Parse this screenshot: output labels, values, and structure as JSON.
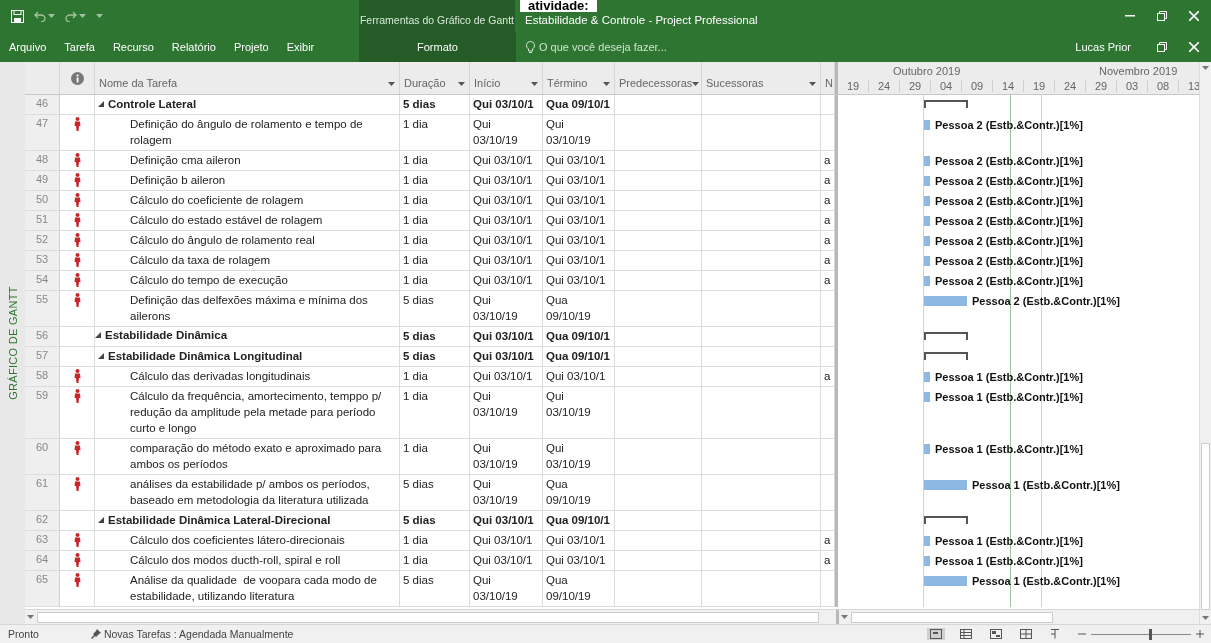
{
  "caption": "atividade:",
  "window": {
    "title": "Estabilidade & Controle - Project Professional",
    "context_group": "Ferramentas do Gráfico de Gantt",
    "search_placeholder": "O que você deseja fazer...",
    "user": "Lucas Prior"
  },
  "ribbon_tabs": [
    {
      "label": "Arquivo",
      "contextual": false
    },
    {
      "label": "Tarefa",
      "contextual": false
    },
    {
      "label": "Recurso",
      "contextual": false
    },
    {
      "label": "Relatório",
      "contextual": false
    },
    {
      "label": "Projeto",
      "contextual": false
    },
    {
      "label": "Exibir",
      "contextual": false
    },
    {
      "label": "Formato",
      "contextual": true
    }
  ],
  "view_label": "GRÁFICO DE GANTT",
  "columns": [
    {
      "label": "Nome da Tarefa",
      "menu": true
    },
    {
      "label": "Duração",
      "menu": true
    },
    {
      "label": "Início",
      "menu": true
    },
    {
      "label": "Término",
      "menu": true
    },
    {
      "label": "Predecessoras",
      "menu": true
    },
    {
      "label": "Sucessoras",
      "menu": true
    },
    {
      "label": "N",
      "menu": false
    }
  ],
  "timescale": {
    "months": [
      "Outubro 2019",
      "Novembro 2019"
    ],
    "days": [
      "19",
      "24",
      "29",
      "04",
      "09",
      "14",
      "19",
      "24",
      "29",
      "03",
      "08",
      "13"
    ]
  },
  "tasks": [
    {
      "children": [
        {
          "id": "46",
          "kind": "summary",
          "expanded": true,
          "overallocated": false,
          "name": "Controle Lateral",
          "duration": "5 dias",
          "start": "Qui 03/10/1",
          "finish": "Qua 09/10/1",
          "children": [
            {
              "id": "47",
              "kind": "task",
              "overallocated": true,
              "name": "Definição do ângulo de rolamento e tempo de rolagem",
              "duration": "1 dia",
              "start": "Qui 03/10/19",
              "finish": "Qui 03/10/19",
              "long_bar": false,
              "resources": "Pessoa 2 (Estb.&Contr.)[1%]"
            },
            {
              "id": "48",
              "kind": "task",
              "overallocated": true,
              "name": "Definição cma aileron",
              "duration": "1 dia",
              "start": "Qui 03/10/1",
              "finish": "Qui 03/10/1",
              "column_n": "a",
              "long_bar": false,
              "resources": "Pessoa 2 (Estb.&Contr.)[1%]"
            },
            {
              "id": "49",
              "kind": "task",
              "overallocated": true,
              "name": "Definição b aileron",
              "duration": "1 dia",
              "start": "Qui 03/10/1",
              "finish": "Qui 03/10/1",
              "column_n": "a",
              "long_bar": false,
              "resources": "Pessoa 2 (Estb.&Contr.)[1%]"
            },
            {
              "id": "50",
              "kind": "task",
              "overallocated": true,
              "name": "Cálculo do coeficiente de rolagem",
              "duration": "1 dia",
              "start": "Qui 03/10/1",
              "finish": "Qui 03/10/1",
              "column_n": "a",
              "long_bar": false,
              "resources": "Pessoa 2 (Estb.&Contr.)[1%]"
            },
            {
              "id": "51",
              "kind": "task",
              "overallocated": true,
              "name": "Cálculo do estado estável de rolagem",
              "duration": "1 dia",
              "start": "Qui 03/10/1",
              "finish": "Qui 03/10/1",
              "column_n": "a",
              "long_bar": false,
              "resources": "Pessoa 2 (Estb.&Contr.)[1%]"
            },
            {
              "id": "52",
              "kind": "task",
              "overallocated": true,
              "name": "Cálculo do ângulo de rolamento real",
              "duration": "1 dia",
              "start": "Qui 03/10/1",
              "finish": "Qui 03/10/1",
              "column_n": "a",
              "long_bar": false,
              "resources": "Pessoa 2 (Estb.&Contr.)[1%]"
            },
            {
              "id": "53",
              "kind": "task",
              "overallocated": true,
              "name": "Cálculo da taxa de rolagem",
              "duration": "1 dia",
              "start": "Qui 03/10/1",
              "finish": "Qui 03/10/1",
              "column_n": "a",
              "long_bar": false,
              "resources": "Pessoa 2 (Estb.&Contr.)[1%]"
            },
            {
              "id": "54",
              "kind": "task",
              "overallocated": true,
              "name": "Cálculo do tempo de execução",
              "duration": "1 dia",
              "start": "Qui 03/10/1",
              "finish": "Qui 03/10/1",
              "column_n": "a",
              "long_bar": false,
              "resources": "Pessoa 2 (Estb.&Contr.)[1%]"
            },
            {
              "id": "55",
              "kind": "task",
              "overallocated": true,
              "name": "Definição das delfexões máxima e mínima dos ailerons",
              "duration": "5 dias",
              "start": "Qui 03/10/19",
              "finish": "Qua 09/10/19",
              "long_bar": true,
              "resources": "Pessoa 2 (Estb.&Contr.)[1%]"
            }
          ]
        }
      ]
    },
    {
      "id": "56",
      "kind": "summary",
      "expanded": true,
      "overallocated": false,
      "name": "Estabilidade Dinâmica",
      "duration": "5 dias",
      "start": "Qui 03/10/1",
      "finish": "Qua 09/10/1",
      "children": [
        {
          "id": "57",
          "kind": "summary",
          "expanded": true,
          "overallocated": false,
          "name": "Estabilidade Dinâmica Longitudinal",
          "duration": "5 dias",
          "start": "Qui 03/10/1",
          "finish": "Qua 09/10/1",
          "children": [
            {
              "id": "58",
              "kind": "task",
              "overallocated": true,
              "name": "Cálculo das derivadas longitudinais",
              "duration": "1 dia",
              "start": "Qui 03/10/1",
              "finish": "Qui 03/10/1",
              "column_n": "a",
              "long_bar": false,
              "resources": "Pessoa 1 (Estb.&Contr.)[1%]"
            },
            {
              "id": "59",
              "kind": "task",
              "overallocated": true,
              "name": "Cálculo da frequência, amortecimento, temppo p/ redução da amplitude pela metade para período curto e longo",
              "duration": "1 dia",
              "start": "Qui 03/10/19",
              "finish": "Qui 03/10/19",
              "long_bar": false,
              "resources": "Pessoa 1 (Estb.&Contr.)[1%]"
            },
            {
              "id": "60",
              "kind": "task",
              "overallocated": true,
              "name": "comparação do método exato e aproximado para ambos os períodos",
              "duration": "1 dia",
              "start": "Qui 03/10/19",
              "finish": "Qui 03/10/19",
              "long_bar": false,
              "resources": "Pessoa 1 (Estb.&Contr.)[1%]"
            },
            {
              "id": "61",
              "kind": "task",
              "overallocated": true,
              "name": "análises da estabilidade p/ ambos os períodos, baseado em metodologia da literatura utilizada",
              "duration": "5 dias",
              "start": "Qui 03/10/19",
              "finish": "Qua 09/10/19",
              "long_bar": true,
              "resources": "Pessoa 1 (Estb.&Contr.)[1%]"
            }
          ]
        },
        {
          "id": "62",
          "kind": "summary",
          "expanded": true,
          "overallocated": false,
          "name": "Estabilidade Dinâmica Lateral-Direcional",
          "duration": "5 dias",
          "start": "Qui 03/10/1",
          "finish": "Qua 09/10/1",
          "children": [
            {
              "id": "63",
              "kind": "task",
              "overallocated": true,
              "name": "Cálculo dos coeficientes látero-direcionais",
              "duration": "1 dia",
              "start": "Qui 03/10/1",
              "finish": "Qui 03/10/1",
              "column_n": "a",
              "long_bar": false,
              "resources": "Pessoa 1 (Estb.&Contr.)[1%]"
            },
            {
              "id": "64",
              "kind": "task",
              "overallocated": true,
              "name": "Cálculo dos modos ducth-roll, spiral e roll",
              "duration": "1 dia",
              "start": "Qui 03/10/1",
              "finish": "Qui 03/10/1",
              "column_n": "a",
              "long_bar": false,
              "resources": "Pessoa 1 (Estb.&Contr.)[1%]"
            },
            {
              "id": "65",
              "kind": "task",
              "overallocated": true,
              "name": "Análise da qualidade  de voopara cada modo de estabilidade, utilizando literatura",
              "duration": "5 dias",
              "start": "Qui 03/10/19",
              "finish": "Qua 09/10/19",
              "long_bar": true,
              "resources": "Pessoa 1 (Estb.&Contr.)[1%]"
            }
          ]
        }
      ]
    }
  ],
  "status_bar": {
    "state": "Pronto",
    "new_tasks": "Novas Tarefas : Agendada Manualmente",
    "zoom": {
      "level": 0.6
    }
  }
}
